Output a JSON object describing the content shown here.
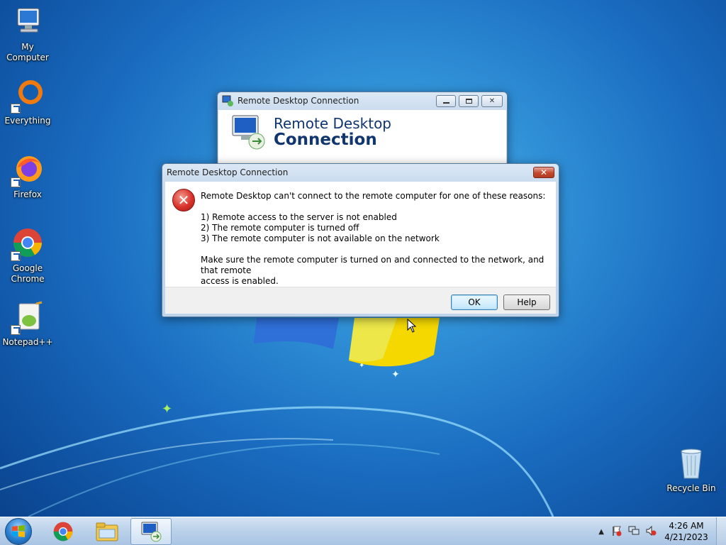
{
  "desktop_icons": [
    {
      "name": "desktop-icon-my-computer",
      "icon": "computer-icon",
      "label": "My Computer"
    },
    {
      "name": "desktop-icon-everything",
      "icon": "everything-search-icon",
      "label": "Everything"
    },
    {
      "name": "desktop-icon-firefox",
      "icon": "firefox-icon",
      "label": "Firefox"
    },
    {
      "name": "desktop-icon-chrome",
      "icon": "chrome-icon",
      "label": "Google Chrome"
    },
    {
      "name": "desktop-icon-notepadpp",
      "icon": "notepadpp-icon",
      "label": "Notepad++"
    },
    {
      "name": "desktop-icon-recycle-bin",
      "icon": "recycle-bin-icon",
      "label": "Recycle Bin"
    }
  ],
  "rdc_window": {
    "title": "Remote Desktop Connection",
    "logo_line1": "Remote Desktop",
    "logo_line2": "Connection"
  },
  "error_dialog": {
    "title": "Remote Desktop Connection",
    "intro": "Remote Desktop can't connect to the remote computer for one of these reasons:",
    "reasons": [
      "1) Remote access to the server is not enabled",
      "2) The remote computer is turned off",
      "3) The remote computer is not available on the network"
    ],
    "advice_line1": "Make sure the remote computer is turned on and connected to the network, and that remote",
    "advice_line2": "access is enabled.",
    "ok_label": "OK",
    "help_label": "Help"
  },
  "taskbar": {
    "time": "4:26 AM",
    "date": "4/21/2023",
    "pinned": [
      "chrome-icon",
      "explorer-icon",
      "remote-desktop-icon"
    ]
  },
  "colors": {
    "desktop_blue": "#1a6cc0",
    "rdc_title_blue": "#10356f",
    "error_red": "#d9322a"
  }
}
